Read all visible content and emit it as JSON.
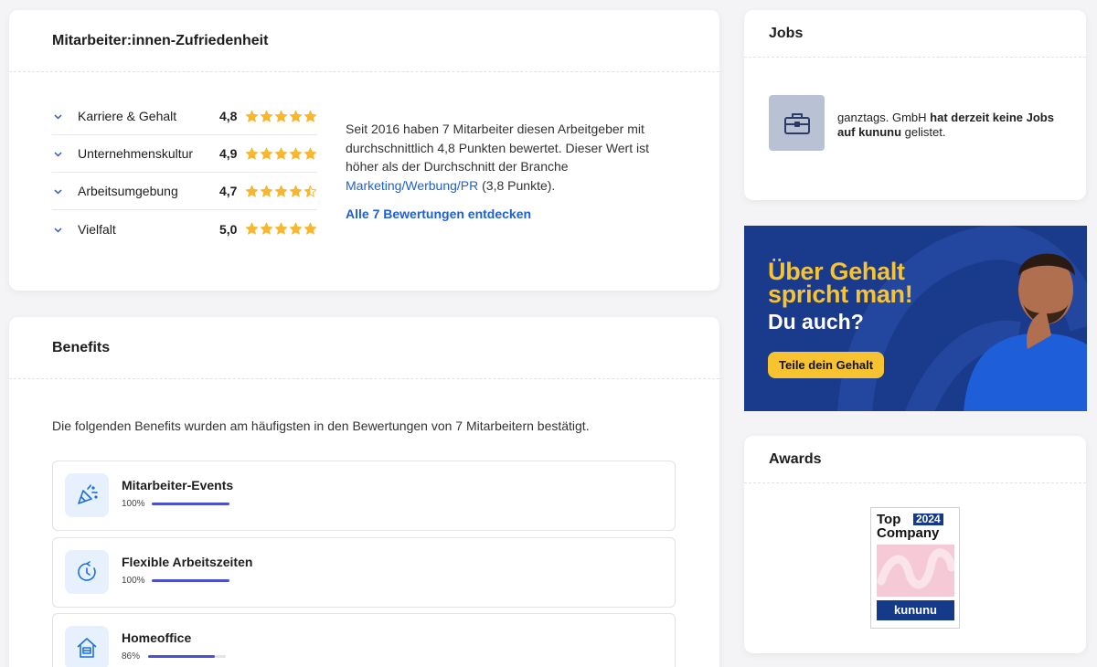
{
  "satisfaction": {
    "title": "Mitarbeiter:innen-Zufriedenheit",
    "factors": [
      {
        "label": "Karriere & Gehalt",
        "score": "4,8",
        "rating": 4.8
      },
      {
        "label": "Unternehmenskultur",
        "score": "4,9",
        "rating": 4.9
      },
      {
        "label": "Arbeitsumgebung",
        "score": "4,7",
        "rating": 4.7
      },
      {
        "label": "Vielfalt",
        "score": "5,0",
        "rating": 5.0
      }
    ],
    "summary_text": "Seit 2016 haben 7 Mitarbeiter diesen Arbeitgeber mit durchschnittlich 4,8 Punkten bewertet. Dieser Wert ist höher als der Durchschnitt der Branche ",
    "branch_link": "Marketing/Werbung/PR",
    "branch_suffix": " (3,8 Punkte).",
    "all_reviews_link": "Alle 7 Bewertungen entdecken",
    "star_color": "#f7b733"
  },
  "benefits": {
    "title": "Benefits",
    "intro": "Die folgenden Benefits wurden am häufigsten in den Bewertungen von 7 Mitarbeitern bestätigt.",
    "items": [
      {
        "name": "Mitarbeiter-Events",
        "percent_label": "100%",
        "percent": 100,
        "icon": "party-popper-icon"
      },
      {
        "name": "Flexible Arbeitszeiten",
        "percent_label": "100%",
        "percent": 100,
        "icon": "clock-icon"
      },
      {
        "name": "Homeoffice",
        "percent_label": "86%",
        "percent": 86,
        "icon": "home-icon"
      }
    ],
    "bar_color": "#4a4fd6"
  },
  "jobs": {
    "title": "Jobs",
    "text_company": "ganztags. GmbH ",
    "text_bold1": "hat derzeit keine Jobs auf kununu",
    "text_end": " gelistet.",
    "icon": "briefcase-icon"
  },
  "banner": {
    "title_line1": "Über Gehalt",
    "title_line2": "spricht man!",
    "subtitle": "Du auch?",
    "button": "Teile dein Gehalt",
    "bg_color": "#1a3a8c",
    "accent_color": "#f7c331"
  },
  "awards": {
    "title": "Awards",
    "badge_top": "Top",
    "badge_year": "2024",
    "badge_company": "Company",
    "badge_brand": "kununu"
  }
}
